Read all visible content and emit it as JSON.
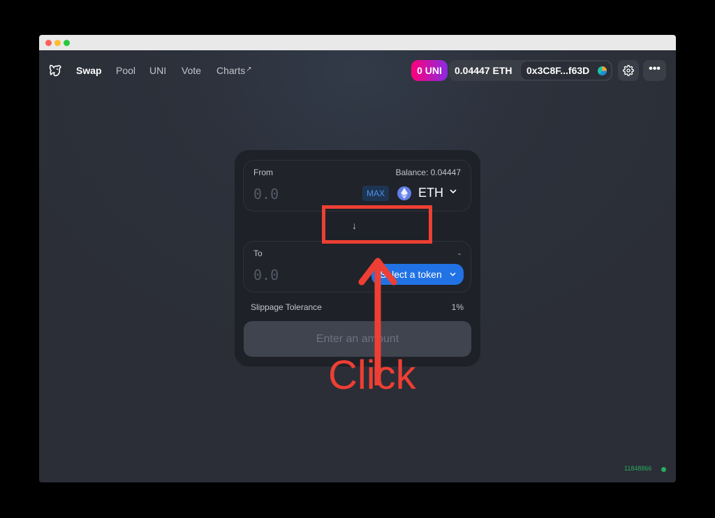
{
  "nav": {
    "items": [
      {
        "label": "Swap"
      },
      {
        "label": "Pool"
      },
      {
        "label": "UNI"
      },
      {
        "label": "Vote"
      },
      {
        "label": "Charts"
      }
    ],
    "charts_external_icon": "↗"
  },
  "header": {
    "uni_badge": "0 UNI",
    "eth_balance": "0.04447 ETH",
    "address": "0x3C8F...f63D",
    "more_label": "•••"
  },
  "swap": {
    "from": {
      "label": "From",
      "balance": "Balance: 0.04447",
      "amount_placeholder": "0.0",
      "max_label": "MAX",
      "token": "ETH"
    },
    "to": {
      "label": "To",
      "right": "-",
      "amount_placeholder": "0.0",
      "select_label": "Select a token"
    },
    "direction_arrow": "↓",
    "slippage_label": "Slippage Tolerance",
    "slippage_value": "1%",
    "submit_label": "Enter an amount"
  },
  "annotation": {
    "text": "Click",
    "color": "#ee3f34"
  },
  "footer": {
    "block_number": "11848866"
  },
  "colors": {
    "accent_blue": "#2172e5",
    "uni_pink": "#ff007a",
    "status_green": "#27ae60"
  }
}
